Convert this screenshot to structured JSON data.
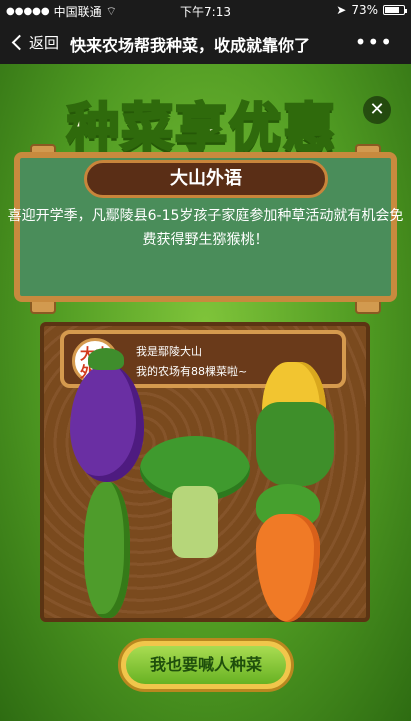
{
  "status_bar": {
    "signal": "●●●●●",
    "carrier": "中国联通",
    "wifi_icon": "wifi-icon",
    "time": "下午7:13",
    "battery": "73%"
  },
  "nav": {
    "back_label": "返回",
    "title": "快来农场帮我种菜，收成就靠你了",
    "more": "•••"
  },
  "page": {
    "headline": "种菜享优惠",
    "close": "✕",
    "plaque": "大山外语",
    "description": "喜迎开学季，凡鄢陵县6-15岁孩子家庭参加种草活动就有机会免费获得野生猕猴桃！",
    "avatar_text": "大山外语",
    "user_line1": "我是鄢陵大山",
    "user_line2": "我的农场有88棵菜啦~",
    "cta": "我也要喊人种菜"
  }
}
